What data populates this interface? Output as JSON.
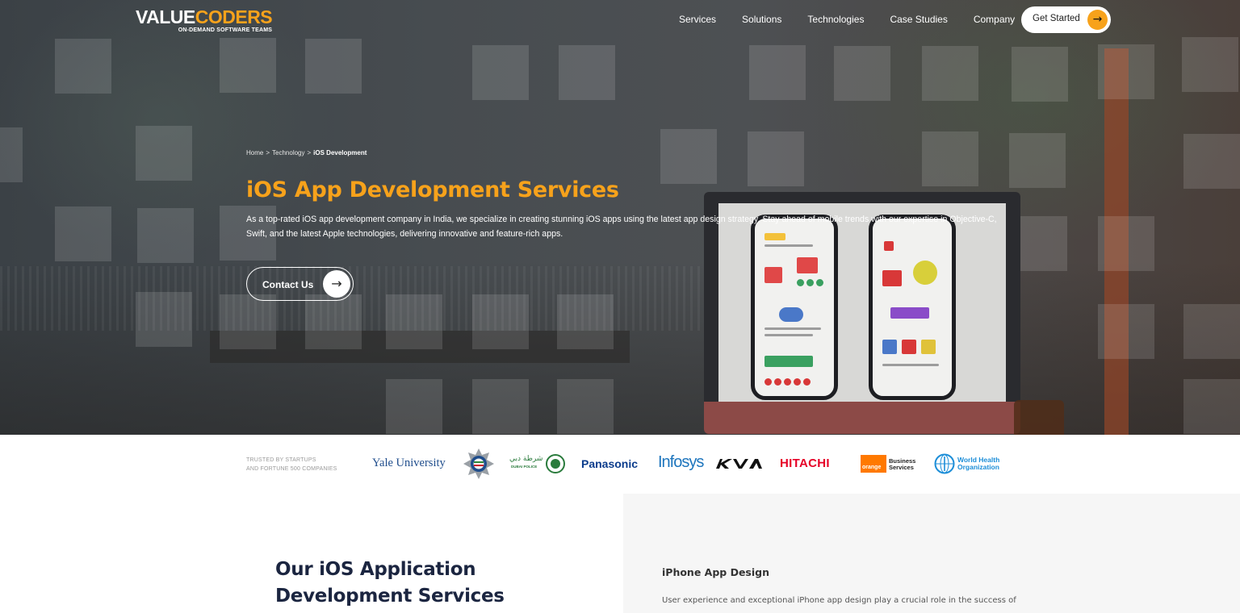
{
  "header": {
    "logo_value": "VALUE",
    "logo_coders": "CODERS",
    "logo_tagline": "ON-DEMAND SOFTWARE TEAMS",
    "nav": [
      "Services",
      "Solutions",
      "Technologies",
      "Case Studies",
      "Company"
    ],
    "cta_label": "Get Started",
    "cta_icon": "→"
  },
  "hero": {
    "breadcrumb": [
      "Home",
      "Technology",
      "iOS Development"
    ],
    "breadcrumb_sep": ">",
    "title": "iOS App Development Services",
    "description": "As a top-rated iOS app development company in India, we specialize in creating stunning iOS apps using the latest app design strategy. Stay ahead of mobile trends with our expertise in Objective-C, Swift, and the latest Apple technologies, delivering innovative and feature-rich apps.",
    "contact_label": "Contact Us",
    "contact_icon": "→"
  },
  "clients": {
    "trusted_line1": "TRUSTED BY STARTUPS",
    "trusted_line2": "AND FORTUNE 500 COMPANIES",
    "yale": "Yale University",
    "dubai_police_ar": "شرطة دبي",
    "dubai_police_en": "DUBAI POLICE",
    "panasonic": "Panasonic",
    "infosys": "Infosys",
    "hitachi": "HITACHI",
    "orange_box": "orange",
    "orange_line1": "Business",
    "orange_line2": "Services",
    "who_line1": "World Health",
    "who_line2": "Organization"
  },
  "services": {
    "heading": "Our iOS Application Development Services",
    "item_title": "iPhone App Design",
    "item_desc": "User experience and exceptional iPhone app design play a crucial role in the success of"
  },
  "colors": {
    "accent": "#f7a21b",
    "navy": "#1b2540"
  }
}
